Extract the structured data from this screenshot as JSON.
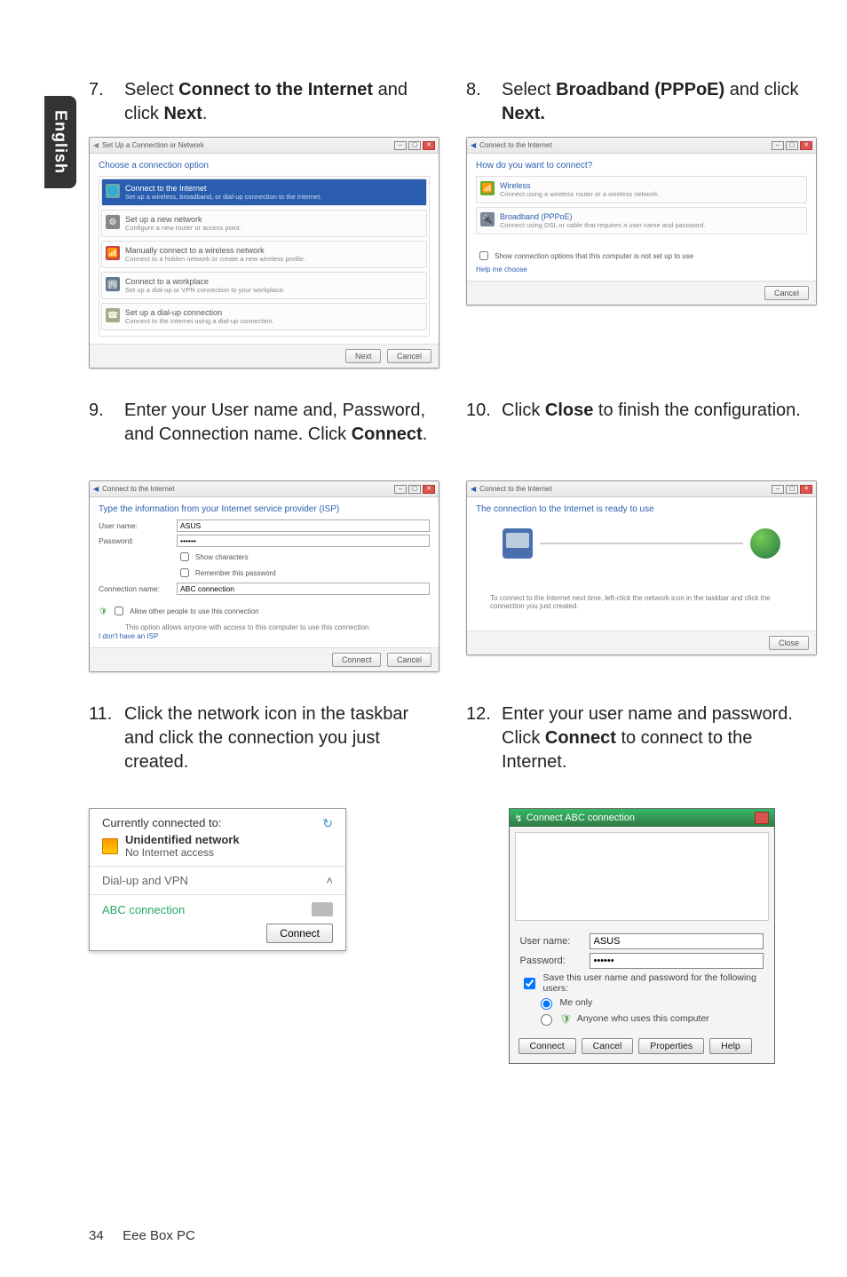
{
  "side_tab": "English",
  "steps": {
    "s7": {
      "num": "7.",
      "pre": "Select ",
      "bold": "Connect to the Internet",
      "mid": " and click ",
      "bold2": "Next",
      "post": "."
    },
    "s8": {
      "num": "8.",
      "pre": "Select ",
      "bold": "Broadband (PPPoE)",
      "mid": " and click ",
      "bold2": "Next.",
      "post": ""
    },
    "s9": {
      "num": "9.",
      "text_a": "Enter your User name and, Password, and Connection name. Click ",
      "bold": "Connect",
      "post": "."
    },
    "s10": {
      "num": "10.",
      "pre": "Click ",
      "bold": "Close",
      "post": " to finish the configuration."
    },
    "s11": {
      "num": "11.",
      "text": "Click the network icon in the taskbar and click the connection you just created."
    },
    "s12": {
      "num": "12.",
      "pre": "Enter your user name and password. Click ",
      "bold": "Connect",
      "post": " to connect to the Internet."
    }
  },
  "dlg7": {
    "title": "Set Up a Connection or Network",
    "heading": "Choose a connection option",
    "options": [
      {
        "main": "Connect to the Internet",
        "sub": "Set up a wireless, broadband, or dial-up connection to the Internet."
      },
      {
        "main": "Set up a new network",
        "sub": "Configure a new router or access point."
      },
      {
        "main": "Manually connect to a wireless network",
        "sub": "Connect to a hidden network or create a new wireless profile."
      },
      {
        "main": "Connect to a workplace",
        "sub": "Set up a dial-up or VPN connection to your workplace."
      },
      {
        "main": "Set up a dial-up connection",
        "sub": "Connect to the Internet using a dial-up connection."
      }
    ],
    "buttons": {
      "next": "Next",
      "cancel": "Cancel"
    }
  },
  "dlg8": {
    "title": "Connect to the Internet",
    "heading": "How do you want to connect?",
    "options": [
      {
        "main": "Wireless",
        "sub": "Connect using a wireless router or a wireless network."
      },
      {
        "main": "Broadband (PPPoE)",
        "sub": "Connect using DSL or cable that requires a user name and password."
      }
    ],
    "show": "Show connection options that this computer is not set up to use",
    "help": "Help me choose",
    "buttons": {
      "cancel": "Cancel"
    }
  },
  "dlg9": {
    "title": "Connect to the Internet",
    "heading": "Type the information from your Internet service provider (ISP)",
    "fields": {
      "user_label": "User name:",
      "user_value": "ASUS",
      "pass_label": "Password:",
      "pass_value": "••••••",
      "show_chars": "Show characters",
      "remember": "Remember this password",
      "conn_label": "Connection name:",
      "conn_value": "ABC connection"
    },
    "allow": "Allow other people to use this connection",
    "allow_sub": "This option allows anyone with access to this computer to use this connection.",
    "isp_link": "I don't have an ISP",
    "buttons": {
      "connect": "Connect",
      "cancel": "Cancel"
    }
  },
  "dlg10": {
    "title": "Connect to the Internet",
    "heading": "The connection to the Internet is ready to use",
    "note": "To connect to the Internet next time, left-click the network icon in the taskbar and click the connection you just created.",
    "buttons": {
      "close": "Close"
    }
  },
  "fly11": {
    "header": "Currently connected to:",
    "refresh": "↻",
    "network_name": "Unidentified network",
    "network_sub": "No Internet access",
    "dial": "Dial-up and VPN",
    "caret": "˄",
    "conn_name": "ABC connection",
    "connect_btn": "Connect"
  },
  "dlg12": {
    "title": "Connect ABC connection",
    "user_label": "User name:",
    "user_value": "ASUS",
    "pass_label": "Password:",
    "pass_value": "••••••",
    "save_chk": "Save this user name and password for the following users:",
    "radio_me": "Me only",
    "radio_any": "Anyone who uses this computer",
    "buttons": {
      "connect": "Connect",
      "cancel": "Cancel",
      "properties": "Properties",
      "help": "Help"
    }
  },
  "footer": {
    "page": "34",
    "title": "Eee Box PC"
  }
}
